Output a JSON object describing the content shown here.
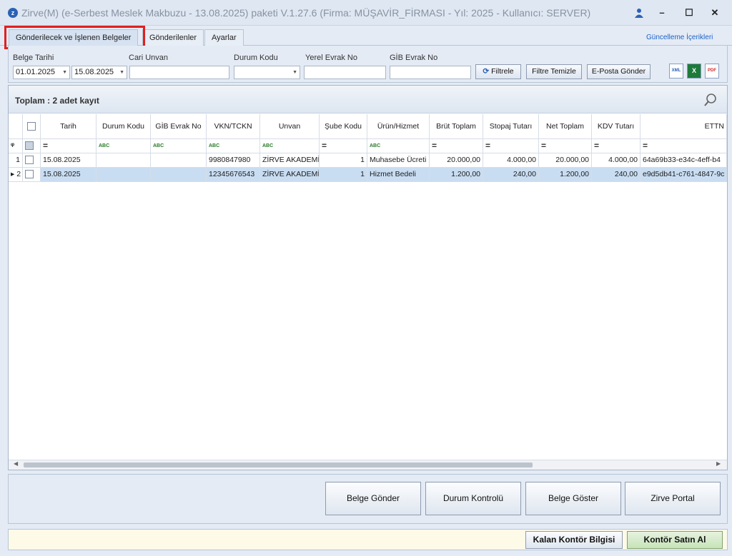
{
  "window": {
    "app_logo": "z",
    "title": "Zirve(M)  (e-Serbest Meslek Makbuzu - 13.08.2025) paketi V.1.27.6 (Firma: MÜŞAVİR_FİRMASI - Yıl: 2025 - Kullanıcı: SERVER)",
    "minimize": "–",
    "maximize": "☐",
    "close": "✕"
  },
  "tabs": [
    {
      "label": "Gönderilecek ve İşlenen Belgeler",
      "active": true
    },
    {
      "label": "Gönderilenler",
      "active": false
    },
    {
      "label": "Ayarlar",
      "active": false
    }
  ],
  "updates_link": "Güncelleme İçerikleri",
  "filters": {
    "belge_tarihi_label": "Belge Tarihi",
    "date_from": "01.01.2025",
    "date_to": "15.08.2025",
    "cari_unvan_label": "Cari Unvan",
    "cari_unvan_value": "",
    "durum_kodu_label": "Durum Kodu",
    "durum_kodu_value": "",
    "yerel_evrak_label": "Yerel Evrak No",
    "yerel_evrak_value": "",
    "gib_evrak_label": "GİB Evrak No",
    "gib_evrak_value": "",
    "filtrele": "Filtrele",
    "filtre_temizle": "Filtre Temizle",
    "eposta_gonder": "E-Posta Gönder",
    "xml_icon_text": "XML",
    "excel_icon_text": "X",
    "pdf_icon_text": "PDF"
  },
  "grid": {
    "total_label": "Toplam : 2 adet kayıt",
    "columns": [
      "Tarih",
      "Durum Kodu",
      "GİB Evrak No",
      "VKN/TCKN",
      "Unvan",
      "Şube Kodu",
      "Ürün/Hizmet",
      "Brüt Toplam",
      "Stopaj Tutarı",
      "Net Toplam",
      "KDV Tutarı",
      "ETTN"
    ],
    "filter_row": {
      "pin": "ᵠ",
      "abc": "ABC",
      "eq": "="
    },
    "rows": [
      {
        "no": "1",
        "tarih": "15.08.2025",
        "durum": "",
        "gib": "",
        "vkn": "9980847980",
        "unvan": "ZİRVE AKADEMİ",
        "sube": "1",
        "urun": "Muhasebe Ücreti",
        "brut": "20.000,00",
        "stopaj": "4.000,00",
        "net": "20.000,00",
        "kdv": "4.000,00",
        "ettn": "64a69b33-e34c-4eff-b4"
      },
      {
        "no": "2",
        "tarih": "15.08.2025",
        "durum": "",
        "gib": "",
        "vkn": "12345676543",
        "unvan": "ZİRVE AKADEMİ",
        "sube": "1",
        "urun": "Hizmet Bedeli",
        "brut": "1.200,00",
        "stopaj": "240,00",
        "net": "1.200,00",
        "kdv": "240,00",
        "ettn": "e9d5db41-c761-4847-9c"
      }
    ]
  },
  "actions": {
    "belge_gonder": "Belge Gönder",
    "durum_kontrolu": "Durum Kontrolü",
    "belge_goster": "Belge Göster",
    "zirve_portal": "Zirve Portal"
  },
  "status": {
    "kalan_kontor": "Kalan Kontör Bilgisi",
    "kontor_satin_al": "Kontör Satın Al"
  },
  "colors": {
    "accent": "#2b62b5",
    "highlight": "#e02020",
    "selected_row": "#c9ddf2"
  }
}
